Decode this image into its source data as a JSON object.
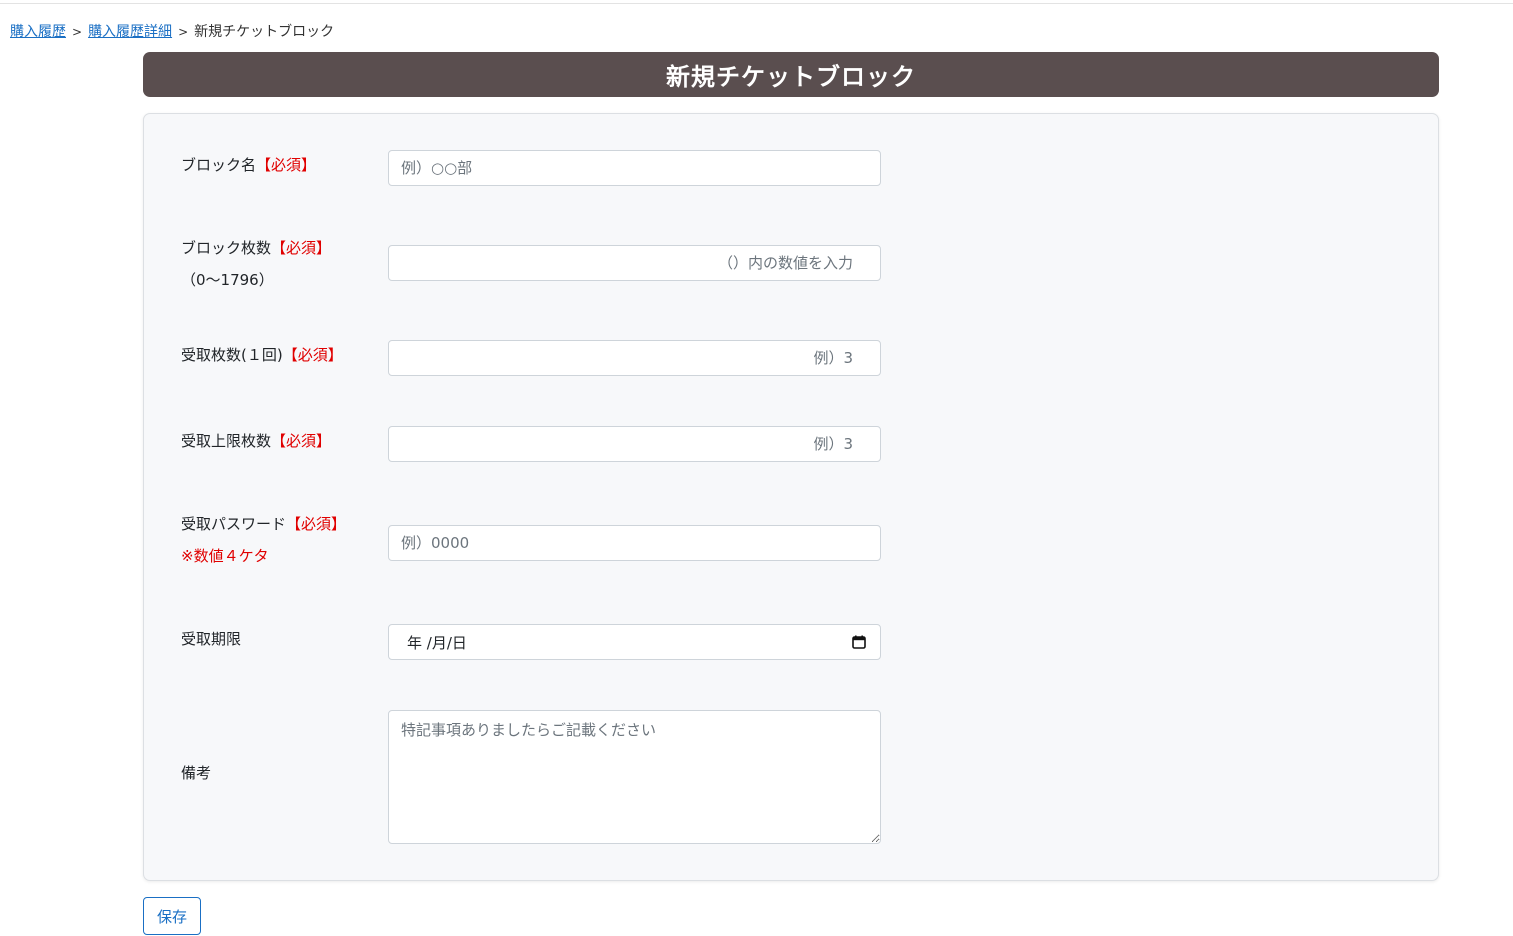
{
  "breadcrumb": {
    "items": [
      {
        "label": "購入履歴",
        "link": true
      },
      {
        "label": "購入履歴詳細",
        "link": true
      }
    ],
    "separator": ">",
    "current": "新規チケットブロック"
  },
  "page": {
    "title": "新規チケットブロック"
  },
  "form": {
    "required_tag": "【必須】",
    "block_name": {
      "label": "ブロック名",
      "placeholder": "例）○○部",
      "value": ""
    },
    "block_count": {
      "label": "ブロック枚数",
      "range_note": "（0～1796）",
      "placeholder": "（）内の数値を入力",
      "value": ""
    },
    "receive_count_once": {
      "label": "受取枚数(１回)",
      "placeholder": "例）3",
      "value": ""
    },
    "receive_limit": {
      "label": "受取上限枚数",
      "placeholder": "例）3",
      "value": ""
    },
    "receive_password": {
      "label": "受取パスワード",
      "note": "※数値４ケタ",
      "placeholder": "例）0000",
      "value": ""
    },
    "receive_deadline": {
      "label": "受取期限",
      "display": "年 /月/日"
    },
    "remarks": {
      "label": "備考",
      "placeholder": "特記事項ありましたらご記載ください",
      "value": ""
    }
  },
  "actions": {
    "save_label": "保存"
  },
  "colors": {
    "title_bar": "#5a4e4f",
    "link": "#1a6fc4",
    "required": "#e00000",
    "card_bg": "#f7f8fa"
  },
  "icons": {
    "date_picker": "calendar-icon"
  }
}
